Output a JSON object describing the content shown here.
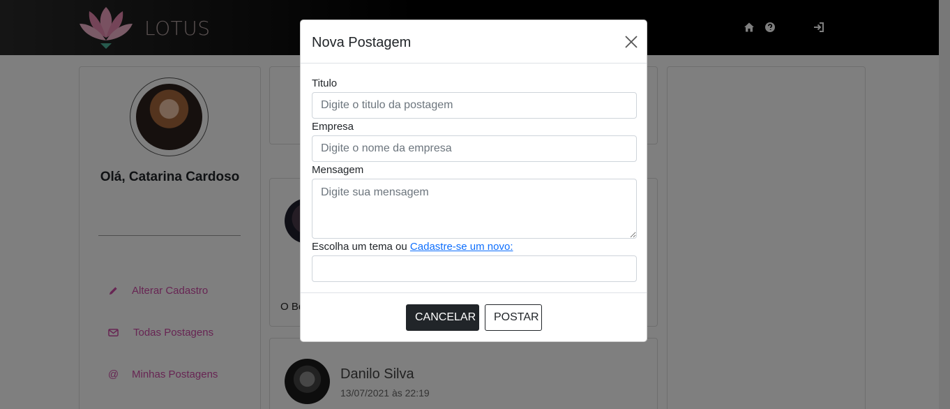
{
  "navbar": {
    "brand": "LOTUS",
    "icons": [
      "home-icon",
      "question-icon",
      "sign-in-icon"
    ]
  },
  "profile": {
    "greeting": "Olá, Catarina Cardoso",
    "links": [
      {
        "label": "Alterar Cadastro",
        "icon": "pencil-icon"
      },
      {
        "label": "Todas Postagens",
        "icon": "envelope-icon"
      },
      {
        "label": "Minhas Postagens",
        "icon": "at-icon"
      }
    ]
  },
  "feed": {
    "partial_text": "O Be",
    "post": {
      "author": "Danilo Silva",
      "date": "13/07/2021 às 22:19"
    }
  },
  "modal": {
    "title": "Nova Postagem",
    "titulo": {
      "label": "Titulo",
      "placeholder": "Digite o titulo da postagem",
      "value": ""
    },
    "empresa": {
      "label": "Empresa",
      "placeholder": "Digite o nome da empresa",
      "value": ""
    },
    "mensagem": {
      "label": "Mensagem",
      "placeholder": "Digite sua mensagem",
      "value": ""
    },
    "tema": {
      "label": "Escolha um tema ou",
      "link": "Cadastre-se um novo:",
      "value": ""
    },
    "cancel_label": "CANCELAR",
    "post_label": "POSTAR"
  },
  "colors": {
    "accent": "#cf4aa6",
    "link": "#0d6efd",
    "dark": "#212529"
  }
}
